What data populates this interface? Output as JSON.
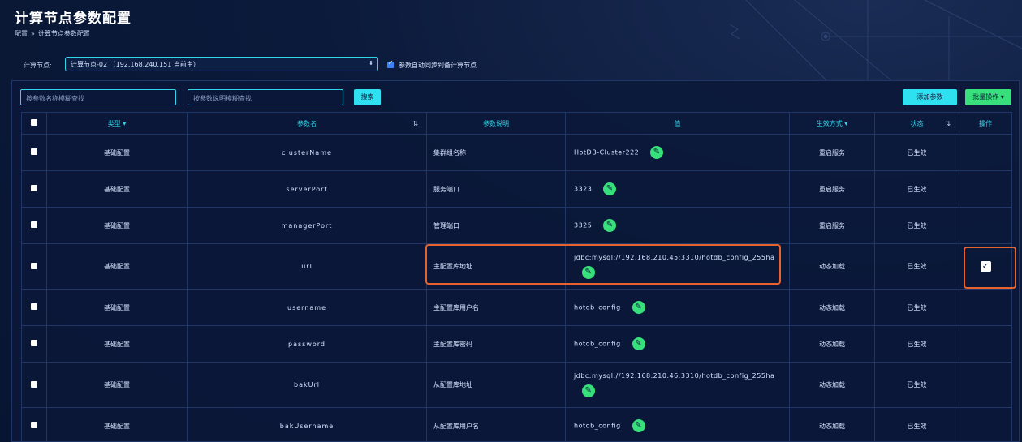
{
  "header": {
    "title": "计算节点参数配置",
    "breadcrumb": [
      "配置",
      "计算节点参数配置"
    ],
    "breadcrumb_sep": "»"
  },
  "node": {
    "label": "计算节点:",
    "selected": "计算节点-02 （192.168.240.151 当前主）",
    "sync_checked": true,
    "sync_label": "参数自动同步到备计算节点"
  },
  "toolbar": {
    "search_name_placeholder": "按参数名称模糊查找",
    "search_desc_placeholder": "按参数说明模糊查找",
    "search_label": "搜索",
    "add_label": "添加参数",
    "batch_label": "批量操作"
  },
  "table": {
    "headers": {
      "type": "类型",
      "name": "参数名",
      "desc": "参数说明",
      "value": "值",
      "mode": "生效方式",
      "status": "状态",
      "action": "操作"
    },
    "rows": [
      {
        "type": "基础配置",
        "name": "clusterName",
        "desc": "集群组名称",
        "value": "HotDB-Cluster222",
        "mode": "重启服务",
        "status": "已生效",
        "checked": false
      },
      {
        "type": "基础配置",
        "name": "serverPort",
        "desc": "服务端口",
        "value": "3323",
        "mode": "重启服务",
        "status": "已生效",
        "checked": false
      },
      {
        "type": "基础配置",
        "name": "managerPort",
        "desc": "管理端口",
        "value": "3325",
        "mode": "重启服务",
        "status": "已生效",
        "checked": false
      },
      {
        "type": "基础配置",
        "name": "url",
        "desc": "主配置库地址",
        "value": "jdbc:mysql://192.168.210.45:3310/hotdb_config_255ha",
        "mode": "动态加载",
        "status": "已生效",
        "checked": true
      },
      {
        "type": "基础配置",
        "name": "username",
        "desc": "主配置库用户名",
        "value": "hotdb_config",
        "mode": "动态加载",
        "status": "已生效",
        "checked": false
      },
      {
        "type": "基础配置",
        "name": "password",
        "desc": "主配置库密码",
        "value": "hotdb_config",
        "mode": "动态加载",
        "status": "已生效",
        "checked": false
      },
      {
        "type": "基础配置",
        "name": "bakUrl",
        "desc": "从配置库地址",
        "value": "jdbc:mysql://192.168.210.46:3310/hotdb_config_255ha",
        "mode": "动态加载",
        "status": "已生效",
        "checked": false
      },
      {
        "type": "基础配置",
        "name": "bakUsername",
        "desc": "从配置库用户名",
        "value": "hotdb_config",
        "mode": "动态加载",
        "status": "已生效",
        "checked": false
      }
    ]
  },
  "colors": {
    "accent": "#2fd5e8",
    "success": "#37e07a",
    "highlight": "#e8622e",
    "background": "#0b1a3a"
  }
}
